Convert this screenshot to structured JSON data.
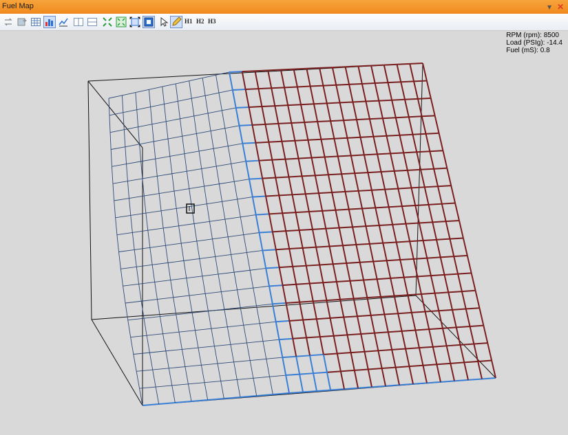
{
  "window": {
    "title": "Fuel Map"
  },
  "toolbar": {
    "tools": [
      {
        "name": "swap-icon"
      },
      {
        "name": "export-icon"
      },
      {
        "name": "table-view-icon"
      },
      {
        "name": "bar-chart-icon",
        "active": true
      },
      {
        "name": "line-chart-icon"
      },
      {
        "name": "split-vertical-icon"
      },
      {
        "name": "split-horizontal-icon"
      },
      {
        "name": "fit-icon"
      },
      {
        "name": "expand-icon"
      },
      {
        "name": "zoom-region-icon"
      },
      {
        "name": "full-view-icon",
        "active": true
      },
      {
        "name": "pointer-icon"
      },
      {
        "name": "pencil-icon",
        "active": true
      }
    ],
    "h1": "H1",
    "h2": "H2",
    "h3": "H3"
  },
  "readout": {
    "rpm": "RPM (rpm): 8500",
    "load": "Load (PSIg): -14.4",
    "fuel": "Fuel (mS): 0.8"
  },
  "colors": {
    "low_mesh": "#2e4a78",
    "highlight_mesh": "#3a7fd6",
    "high_mesh": "#7a1f1f",
    "box": "#111111",
    "title_bar": "#f2951f",
    "background": "#d9d9d9"
  }
}
